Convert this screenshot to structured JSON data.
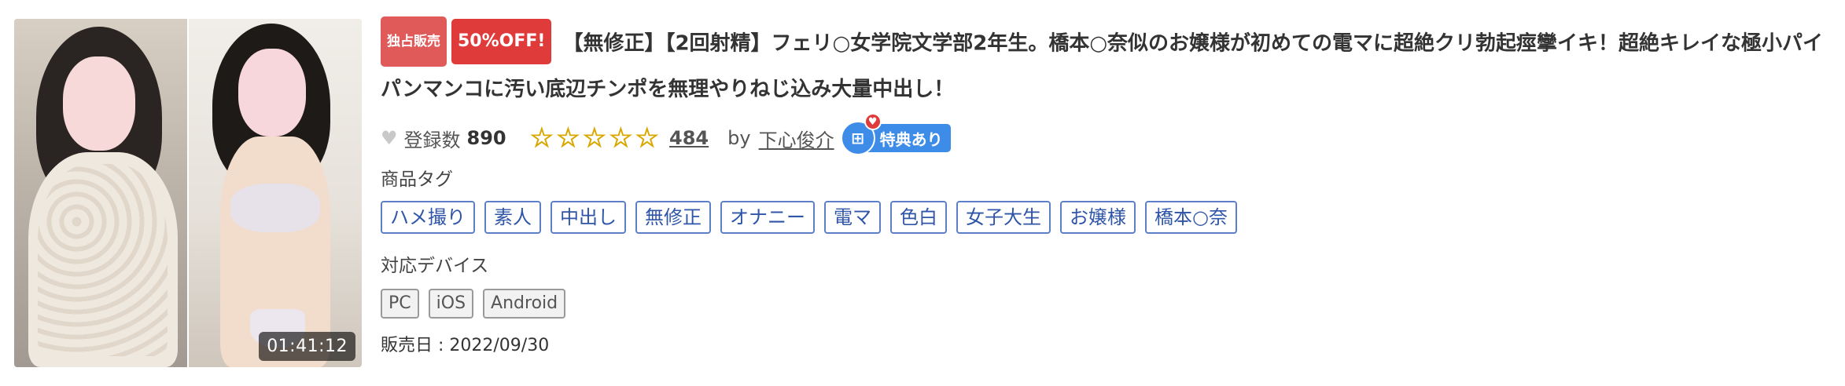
{
  "thumbnail": {
    "duration": "01:41:12"
  },
  "badges": {
    "exclusive": "独占販売",
    "sale": "50%OFF!"
  },
  "title": "【無修正】【2回射精】フェリ○女学院文学部2年生。橋本○奈似のお嬢様が初めての電マに超絶クリ勃起痙攣イキ！超絶キレイな極小パイパンマンコに汚い底辺チンポを無理やりねじ込み大量中出し！",
  "meta": {
    "favorite_label": "登録数",
    "favorite_count": "890",
    "rating_stars": 5,
    "stars_text": "☆☆☆☆☆",
    "review_count": "484",
    "by_label": "by",
    "creator_name": "下心俊介",
    "perk_label": "特典あり"
  },
  "tags": {
    "label": "商品タグ",
    "items": [
      "ハメ撮り",
      "素人",
      "中出し",
      "無修正",
      "オナニー",
      "電マ",
      "色白",
      "女子大生",
      "お嬢様",
      "橋本○奈"
    ]
  },
  "devices": {
    "label": "対応デバイス",
    "items": [
      "PC",
      "iOS",
      "Android"
    ]
  },
  "release": {
    "text": "販売日 : 2022/09/30"
  },
  "colors": {
    "badge_exclusive": "#e05a5a",
    "badge_sale": "#e03b3b",
    "star": "#f5d50a",
    "tag_border": "#5c7fc7",
    "perk": "#3d8ce8"
  }
}
